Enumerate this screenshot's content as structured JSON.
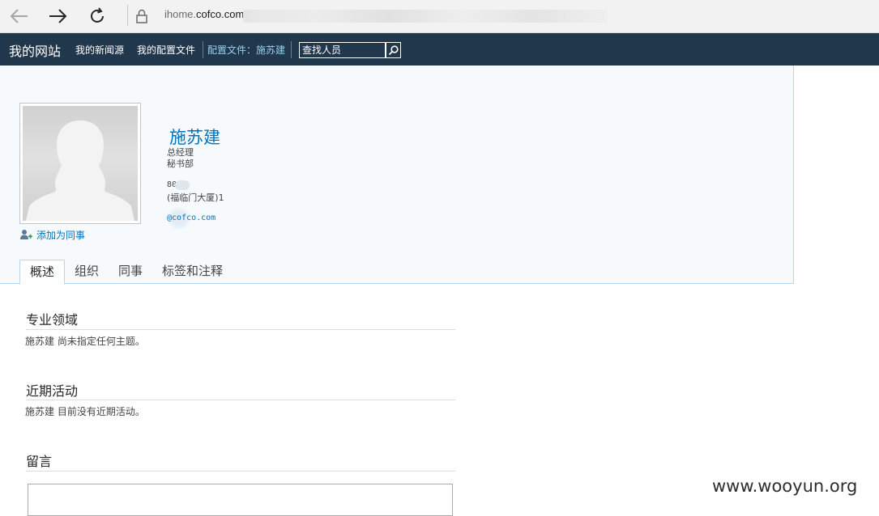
{
  "browser": {
    "address_prefix": "ihome.",
    "address_host": "cofco.com",
    "icons": [
      "back-arrow-icon",
      "forward-arrow-icon",
      "refresh-icon",
      "lock-icon"
    ]
  },
  "topnav": {
    "site": "我的网站",
    "news": "我的新闻源",
    "profile": "我的配置文件",
    "current": "配置文件：施苏建",
    "search_placeholder": "查找人员"
  },
  "profile": {
    "name": "施苏建",
    "title": "总经理",
    "department": "秘书部",
    "phone": "80",
    "office": "(福临门大厦)1",
    "email": "@cofco.com",
    "add_colleague": "添加为同事"
  },
  "tabs": [
    {
      "label": "概述",
      "active": true
    },
    {
      "label": "组织",
      "active": false
    },
    {
      "label": "同事",
      "active": false
    },
    {
      "label": "标签和注释",
      "active": false
    }
  ],
  "sections": {
    "expertise_title": "专业领域",
    "expertise_text": "施苏建 尚未指定任何主题。",
    "activity_title": "近期活动",
    "activity_text": "施苏建 目前没有近期活动。",
    "notes_title": "留言"
  },
  "watermark": "www.wooyun.org",
  "colors": {
    "nav_bg": "#21374c",
    "link": "#0072bc",
    "header_bg": "#f6fafd",
    "border_accent": "#b9d7ec"
  }
}
